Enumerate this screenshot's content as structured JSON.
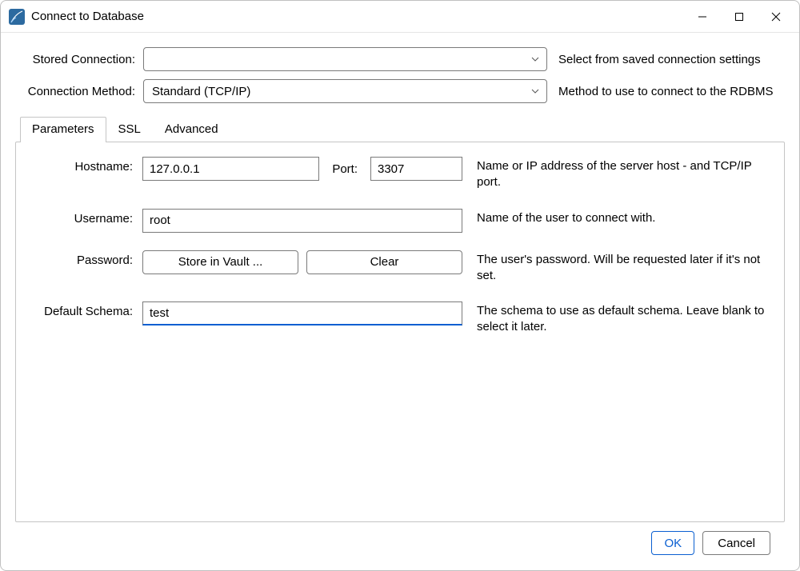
{
  "window": {
    "title": "Connect to Database"
  },
  "rows": {
    "stored_connection": {
      "label": "Stored Connection:",
      "value": "",
      "desc": "Select from saved connection settings"
    },
    "connection_method": {
      "label": "Connection Method:",
      "value": "Standard (TCP/IP)",
      "desc": "Method to use to connect to the RDBMS"
    }
  },
  "tabs": {
    "parameters": "Parameters",
    "ssl": "SSL",
    "advanced": "Advanced"
  },
  "form": {
    "hostname": {
      "label": "Hostname:",
      "value": "127.0.0.1",
      "port_label": "Port:",
      "port_value": "3307",
      "desc": "Name or IP address of the server host - and TCP/IP port."
    },
    "username": {
      "label": "Username:",
      "value": "root",
      "desc": "Name of the user to connect with."
    },
    "password": {
      "label": "Password:",
      "store_label": "Store in Vault ...",
      "clear_label": "Clear",
      "desc": "The user's password. Will be requested later if it's not set."
    },
    "default_schema": {
      "label": "Default Schema:",
      "value": "test",
      "desc": "The schema to use as default schema. Leave blank to select it later."
    }
  },
  "footer": {
    "ok": "OK",
    "cancel": "Cancel"
  }
}
